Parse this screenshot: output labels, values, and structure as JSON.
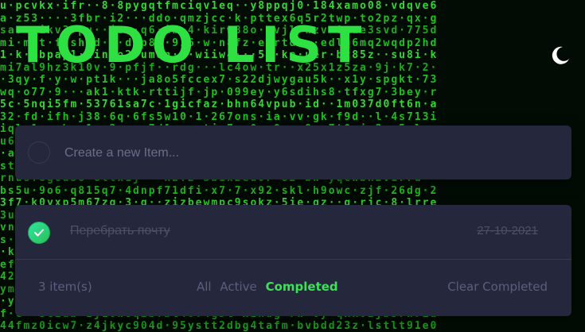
{
  "app": {
    "title": "TODO LIST"
  },
  "theme_toggle": {
    "icon": "moon-icon"
  },
  "new_item": {
    "placeholder": "Create a new Item..."
  },
  "todos": [
    {
      "text": "Перебрать почту",
      "date": "27-10-2021",
      "completed": true
    }
  ],
  "footer": {
    "count_label": "3 item(s)",
    "filters": [
      "All",
      "Active",
      "Completed"
    ],
    "active_filter": "Completed",
    "clear_label": "Clear Completed"
  },
  "colors": {
    "accent": "#2fe043",
    "card": "#25273c",
    "matrix": "#20c020"
  }
}
